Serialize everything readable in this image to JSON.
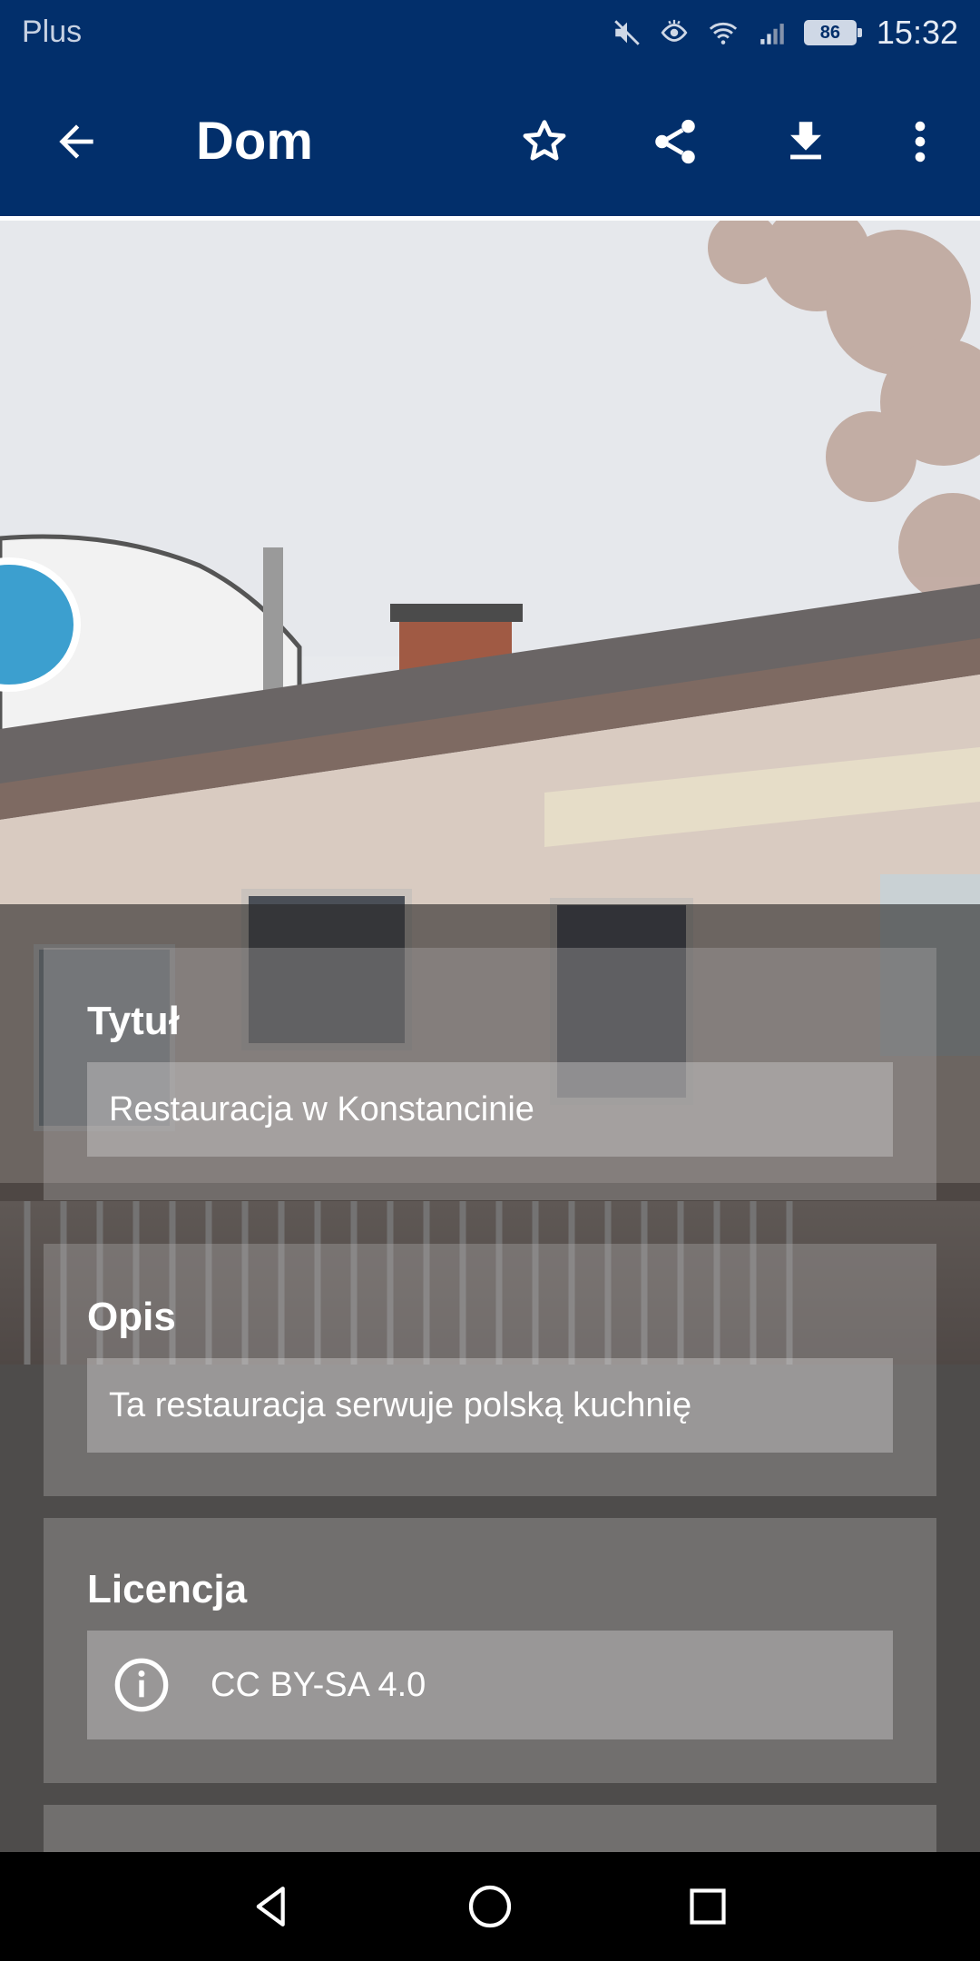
{
  "status_bar": {
    "carrier": "Plus",
    "battery": "86",
    "time": "15:32"
  },
  "app_bar": {
    "title": "Dom",
    "icons": [
      "back-arrow-icon",
      "star-icon",
      "share-icon",
      "download-icon",
      "more-vert-icon"
    ]
  },
  "details": {
    "title": {
      "label": "Tytuł",
      "value": "Restauracja w Konstancinie"
    },
    "description": {
      "label": "Opis",
      "value": "Ta restauracja serwuje polską kuchnię"
    },
    "license": {
      "label": "Licencja",
      "value": "CC BY-SA 4.0",
      "icon": "info-icon"
    }
  },
  "navigation_bar": {
    "icons": [
      "nav-back-icon",
      "nav-home-icon",
      "nav-recents-icon"
    ]
  }
}
